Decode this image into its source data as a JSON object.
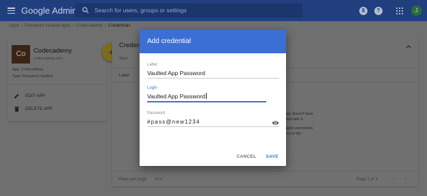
{
  "topbar": {
    "brand": "Google Admin",
    "search_placeholder": "Search for users, groups or settings",
    "avatar_initial": "J"
  },
  "breadcrumb": [
    "Apps",
    "Password vaulted apps",
    "Codecademy",
    "Credentials"
  ],
  "app_card": {
    "logo_text": "Co",
    "name": "Codecademy",
    "domain": "codecademy.com",
    "app_line": "App: Codecademy",
    "type_line": "Type: Password Vaulted",
    "edit_label": "EDIT APP",
    "delete_label": "DELETE APP"
  },
  "fab_label": "+",
  "panel": {
    "title": "Credenti",
    "search_placeholder": "Sear",
    "column_label": "Label",
    "hint_lines": [
      "app doesn't have",
      "ated with it.",
      "",
      "aged usernames",
      "ess to the"
    ],
    "rows_per_page_label": "Rows per page",
    "rows_per_page_value": "10",
    "pager_text": "Page 1 of 1"
  },
  "modal": {
    "title": "Add credential",
    "label_field": {
      "label": "Label",
      "value": "Vaulted App Password"
    },
    "login_field": {
      "label": "Login",
      "value": "Vaulted App Password"
    },
    "password_field": {
      "label": "Password",
      "value": "#pass@new1234"
    },
    "cancel_label": "CANCEL",
    "save_label": "SAVE"
  },
  "colors": {
    "accent": "#3b6fd6",
    "topbar_dimmed": "#213f7f"
  }
}
